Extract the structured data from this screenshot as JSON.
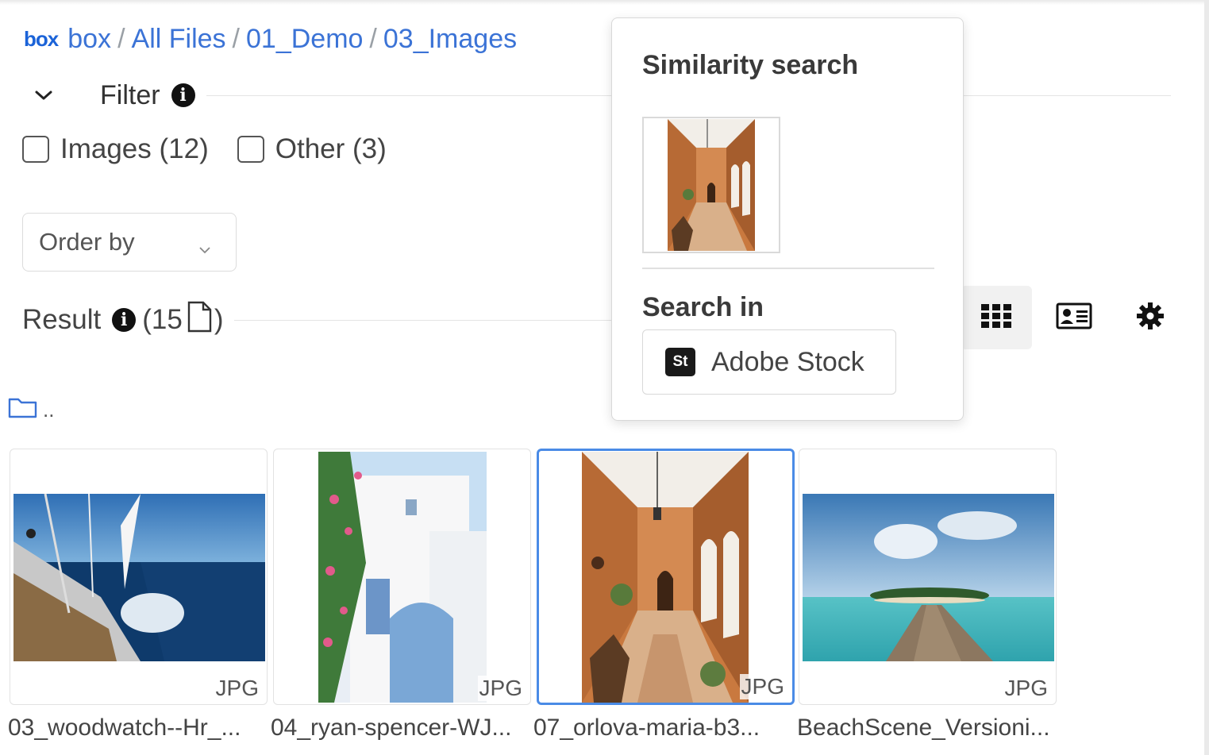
{
  "breadcrumb": {
    "logo": "box",
    "items": [
      "box",
      "All Files",
      "01_Demo",
      "03_Images"
    ],
    "separator": "/"
  },
  "filter": {
    "label": "Filter",
    "info_icon": "info-icon",
    "checkboxes": [
      {
        "label": "Images (12)",
        "checked": false
      },
      {
        "label": "Other (3)",
        "checked": false
      }
    ]
  },
  "order_by": {
    "label": "Order by"
  },
  "result": {
    "label": "Result",
    "count_text": "(15",
    "close_paren": ")"
  },
  "parent_folder": {
    "label": ".."
  },
  "view_controls": [
    "grid-view-icon",
    "card-view-icon",
    "gear-icon"
  ],
  "files": [
    {
      "name": "03_woodwatch--Hr_...",
      "format": "JPG",
      "selected": false
    },
    {
      "name": "04_ryan-spencer-WJ...",
      "format": "JPG",
      "selected": false
    },
    {
      "name": "07_orlova-maria-b3...",
      "format": "JPG",
      "selected": true
    },
    {
      "name": "BeachScene_Versioni...",
      "format": "JPG",
      "selected": false
    }
  ],
  "popover": {
    "title": "Similarity search",
    "search_in_label": "Search in",
    "source_badge": "St",
    "source_label": "Adobe Stock"
  },
  "colors": {
    "link": "#3b73d6",
    "selected_border": "#4a8be6",
    "badge_bg": "#1a1a1a"
  }
}
